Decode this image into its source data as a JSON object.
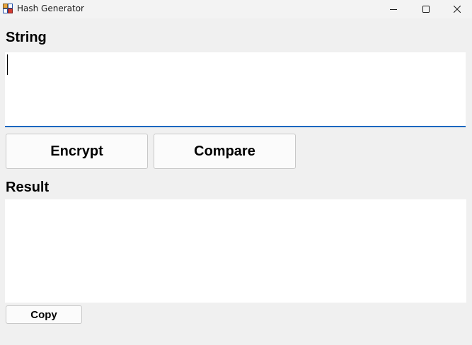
{
  "window": {
    "title": "Hash Generator",
    "icons": {
      "app": "app-icon",
      "minimize": "minimize-icon",
      "maximize": "maximize-icon",
      "close": "close-icon"
    }
  },
  "string_section": {
    "label": "String",
    "input_value": ""
  },
  "actions": {
    "encrypt_label": "Encrypt",
    "compare_label": "Compare"
  },
  "result_section": {
    "label": "Result",
    "output_value": ""
  },
  "copy_label": "Copy",
  "colors": {
    "background": "#f0f0f0",
    "focus_accent": "#0067c0",
    "button_face": "#fbfbfb",
    "button_border": "#c8c8c8"
  }
}
